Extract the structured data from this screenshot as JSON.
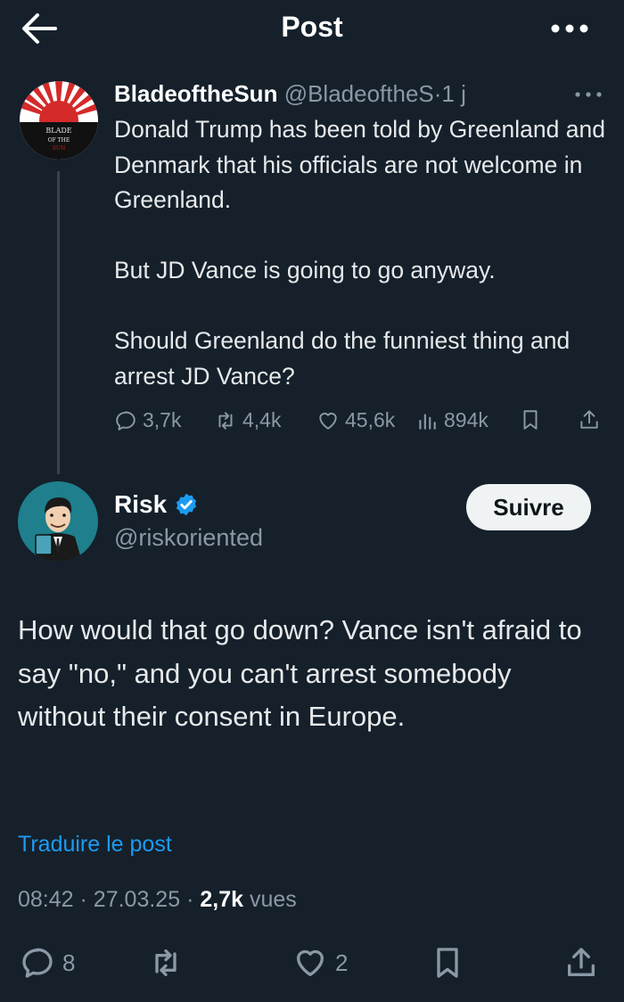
{
  "header": {
    "title": "Post",
    "back_icon": "arrow-left-icon",
    "more_icon": "more-dots-icon"
  },
  "parent_post": {
    "display_name": "BladeoftheSun",
    "handle": "@BladeoftheS",
    "separator": "·",
    "age": "1 j",
    "body": [
      "Donald Trump has been told by Greenland and Denmark that his officials are not welcome in Greenland.",
      "But JD Vance is going to go anyway.",
      "Should Greenland do the funniest thing and arrest JD Vance?"
    ],
    "avatar_text": [
      "BLADE",
      "OF THE",
      "SUN"
    ],
    "stats": {
      "replies": "3,7k",
      "reposts": "4,4k",
      "likes": "45,6k",
      "views": "894k"
    }
  },
  "reply": {
    "display_name": "Risk",
    "handle": "@riskoriented",
    "follow_label": "Suivre",
    "body": "How would that go down? Vance isn't afraid to say \"no,\" and you can't arrest somebody without their consent in Europe.",
    "translate_label": "Traduire le post",
    "time": "08:42",
    "date": "27.03.25",
    "views_count": "2,7k",
    "views_label": "vues",
    "dot": "·"
  },
  "actions": {
    "replies": "8",
    "likes": "2"
  },
  "colors": {
    "background": "#15202b",
    "text": "#e7e9ea",
    "muted": "#8b98a5",
    "link": "#1d9bf0",
    "verified": "#1d9bf0"
  }
}
